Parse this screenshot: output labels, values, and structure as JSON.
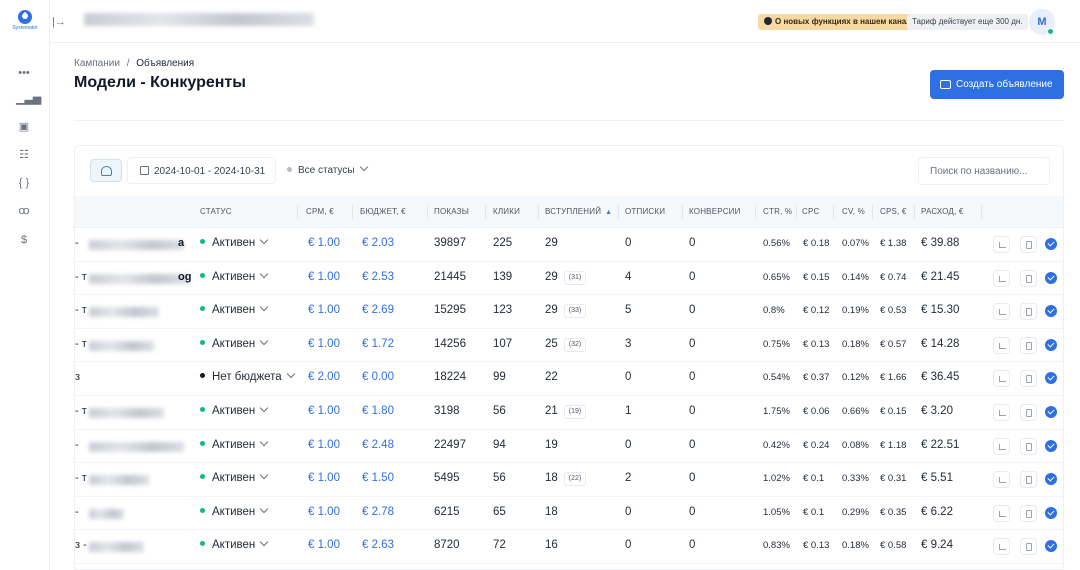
{
  "sidebar": {
    "logo_text": "Systemator",
    "items": [
      {
        "icon": "more-dots-icon",
        "glyph": "•••"
      },
      {
        "icon": "bar-chart-icon",
        "glyph": "▁▃▅"
      },
      {
        "icon": "image-icon",
        "glyph": "▣"
      },
      {
        "icon": "list-settings-icon",
        "glyph": "☷"
      },
      {
        "icon": "code-braces-icon",
        "glyph": "{ }"
      },
      {
        "icon": "users-icon",
        "glyph": "ꝏ"
      },
      {
        "icon": "dollar-icon",
        "glyph": "$"
      }
    ]
  },
  "topbar": {
    "collapse_glyph": "|→",
    "news_badge": "О новых функциях в нашем канале",
    "tariff_badge": "Тариф действует еще 300 дн.",
    "avatar_letter": "M"
  },
  "breadcrumb": {
    "parent": "Кампании",
    "separator": "/",
    "current": "Объявления"
  },
  "page_title": "Модели - Конкуренты",
  "create_button": "Создать объявление",
  "filters": {
    "date_range": "2024-10-01 - 2024-10-31",
    "status": "Все статусы",
    "search_placeholder": "Поиск по названию..."
  },
  "columns": {
    "status": "СТАТУС",
    "cpm": "CPM, €",
    "budget": "БЮДЖЕТ, €",
    "shows": "ПОКАЗЫ",
    "clicks": "КЛИКИ",
    "joins": "ВСТУПЛЕНИЙ",
    "unsubs": "ОТПИСКИ",
    "conversions": "КОНВЕРСИИ",
    "ctr": "CTR, %",
    "cpc": "CPC",
    "cv": "CV, %",
    "cps": "CPS, €",
    "spend": "РАСХОД, €"
  },
  "colors": {
    "active": "#10b981",
    "no_budget": "#111827",
    "accent": "#2f6fe4"
  },
  "rows": [
    {
      "dash": "-",
      "tail": "a",
      "status": "Активен",
      "status_color": "#10b981",
      "cpm": "€ 1.00",
      "budget": "€ 2.03",
      "shows": "39897",
      "clicks": "225",
      "joins": "29",
      "joins_badge": "",
      "unsubs": "0",
      "conversions": "0",
      "ctr": "0.56%",
      "cpc": "€ 0.18",
      "cv": "0.07%",
      "cps": "€ 1.38",
      "spend": "€ 39.88"
    },
    {
      "dash": "- т",
      "tail": "og",
      "status": "Активен",
      "status_color": "#10b981",
      "cpm": "€ 1.00",
      "budget": "€ 2.53",
      "shows": "21445",
      "clicks": "139",
      "joins": "29",
      "joins_badge": "(31)",
      "unsubs": "4",
      "conversions": "0",
      "ctr": "0.65%",
      "cpc": "€ 0.15",
      "cv": "0.14%",
      "cps": "€ 0.74",
      "spend": "€ 21.45"
    },
    {
      "dash": "- т",
      "tail": "",
      "status": "Активен",
      "status_color": "#10b981",
      "cpm": "€ 1.00",
      "budget": "€ 2.69",
      "shows": "15295",
      "clicks": "123",
      "joins": "29",
      "joins_badge": "(33)",
      "unsubs": "5",
      "conversions": "0",
      "ctr": "0.8%",
      "cpc": "€ 0.12",
      "cv": "0.19%",
      "cps": "€ 0.53",
      "spend": "€ 15.30"
    },
    {
      "dash": "- т",
      "tail": "",
      "status": "Активен",
      "status_color": "#10b981",
      "cpm": "€ 1.00",
      "budget": "€ 1.72",
      "shows": "14256",
      "clicks": "107",
      "joins": "25",
      "joins_badge": "(32)",
      "unsubs": "3",
      "conversions": "0",
      "ctr": "0.75%",
      "cpc": "€ 0.13",
      "cv": "0.18%",
      "cps": "€ 0.57",
      "spend": "€ 14.28"
    },
    {
      "dash": "з",
      "tail": "",
      "status": "Нет бюджета",
      "status_color": "#111827",
      "cpm": "€ 2.00",
      "budget": "€ 0.00",
      "shows": "18224",
      "clicks": "99",
      "joins": "22",
      "joins_badge": "",
      "unsubs": "0",
      "conversions": "0",
      "ctr": "0.54%",
      "cpc": "€ 0.37",
      "cv": "0.12%",
      "cps": "€ 1.66",
      "spend": "€ 36.45"
    },
    {
      "dash": "- т",
      "tail": "",
      "status": "Активен",
      "status_color": "#10b981",
      "cpm": "€ 1.00",
      "budget": "€ 1.80",
      "shows": "3198",
      "clicks": "56",
      "joins": "21",
      "joins_badge": "(19)",
      "unsubs": "1",
      "conversions": "0",
      "ctr": "1.75%",
      "cpc": "€ 0.06",
      "cv": "0.66%",
      "cps": "€ 0.15",
      "spend": "€ 3.20"
    },
    {
      "dash": "-",
      "tail": "",
      "status": "Активен",
      "status_color": "#10b981",
      "cpm": "€ 1.00",
      "budget": "€ 2.48",
      "shows": "22497",
      "clicks": "94",
      "joins": "19",
      "joins_badge": "",
      "unsubs": "0",
      "conversions": "0",
      "ctr": "0.42%",
      "cpc": "€ 0.24",
      "cv": "0.08%",
      "cps": "€ 1.18",
      "spend": "€ 22.51"
    },
    {
      "dash": "- т",
      "tail": "",
      "status": "Активен",
      "status_color": "#10b981",
      "cpm": "€ 1.00",
      "budget": "€ 1.50",
      "shows": "5495",
      "clicks": "56",
      "joins": "18",
      "joins_badge": "(22)",
      "unsubs": "2",
      "conversions": "0",
      "ctr": "1.02%",
      "cpc": "€ 0.1",
      "cv": "0.33%",
      "cps": "€ 0.31",
      "spend": "€ 5.51"
    },
    {
      "dash": "-",
      "tail": "",
      "status": "Активен",
      "status_color": "#10b981",
      "cpm": "€ 1.00",
      "budget": "€ 2.78",
      "shows": "6215",
      "clicks": "65",
      "joins": "18",
      "joins_badge": "",
      "unsubs": "0",
      "conversions": "0",
      "ctr": "1.05%",
      "cpc": "€ 0.1",
      "cv": "0.29%",
      "cps": "€ 0.35",
      "spend": "€ 6.22"
    },
    {
      "dash": "з -",
      "tail": "",
      "status": "Активен",
      "status_color": "#10b981",
      "cpm": "€ 1.00",
      "budget": "€ 2.63",
      "shows": "8720",
      "clicks": "72",
      "joins": "16",
      "joins_badge": "",
      "unsubs": "0",
      "conversions": "0",
      "ctr": "0.83%",
      "cpc": "€ 0.13",
      "cv": "0.18%",
      "cps": "€ 0.58",
      "spend": "€ 9.24"
    }
  ]
}
